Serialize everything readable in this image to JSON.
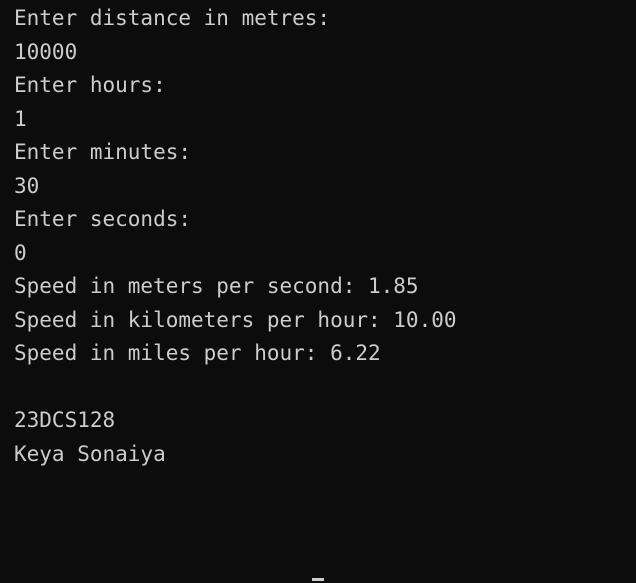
{
  "terminal": {
    "lines": [
      "Enter distance in metres:",
      "10000",
      "Enter hours:",
      "1",
      "Enter minutes:",
      "30",
      "Enter seconds:",
      "0",
      "Speed in meters per second: 1.85",
      "Speed in kilometers per hour: 10.00",
      "Speed in miles per hour: 6.22",
      "",
      "23DCS128",
      "Keya Sonaiya"
    ]
  }
}
